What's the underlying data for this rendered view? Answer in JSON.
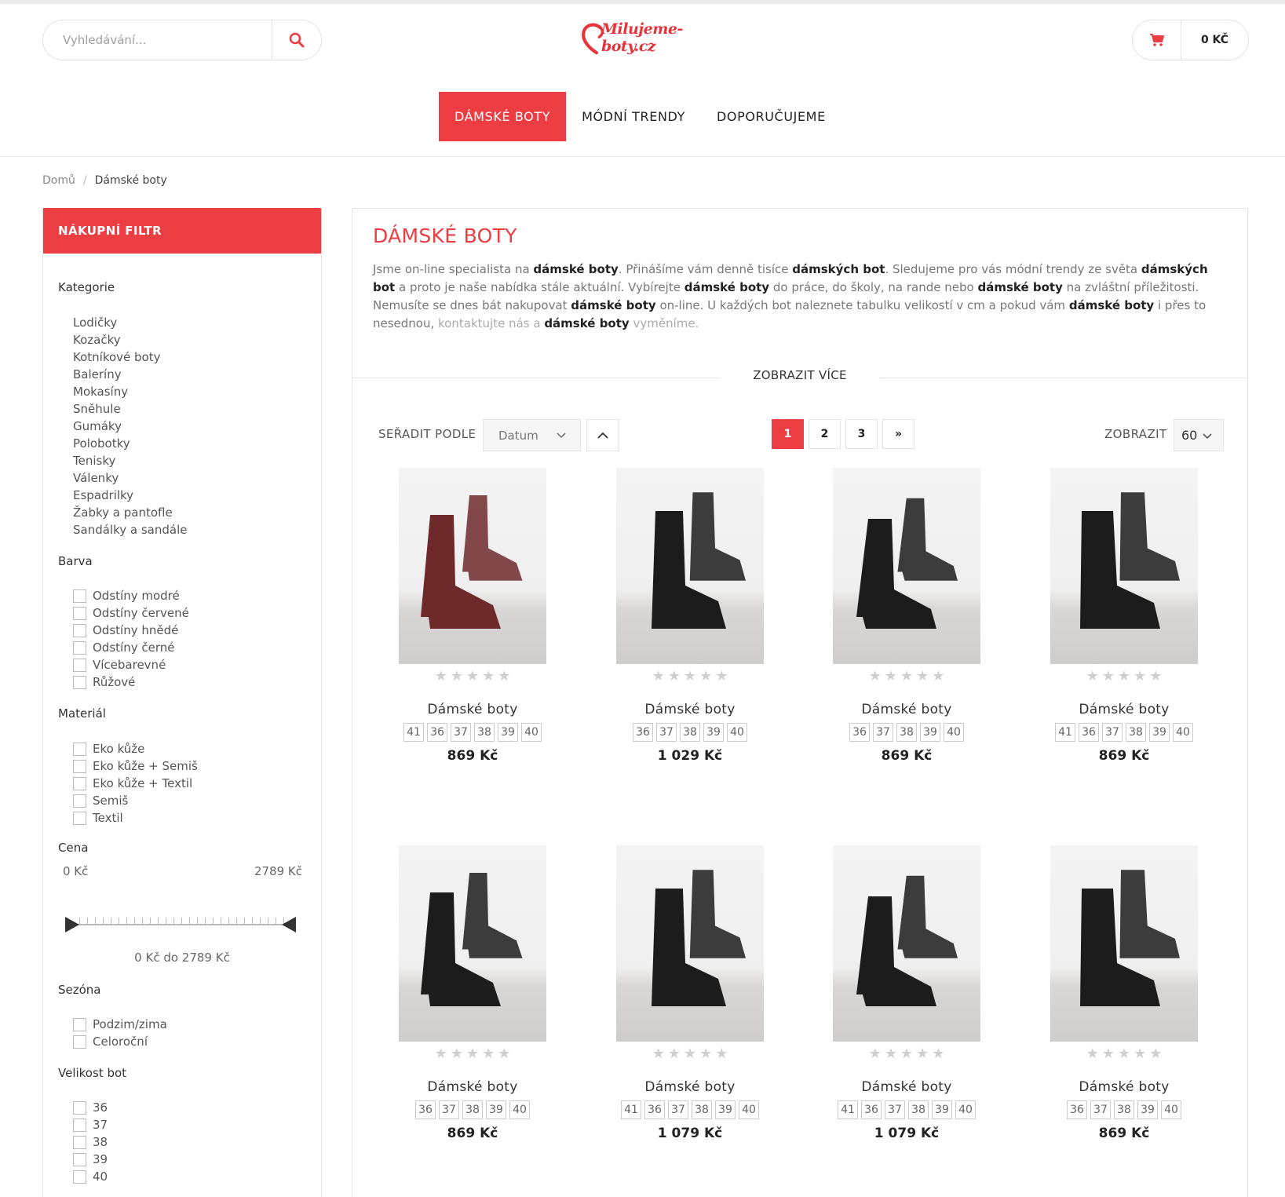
{
  "header": {
    "search_placeholder": "Vyhledávání...",
    "logo_text": "Milujeme-boty.cz",
    "cart_total": "0 KČ"
  },
  "nav": [
    {
      "label": "DÁMSKÉ BOTY",
      "active": true
    },
    {
      "label": "MÓDNÍ TRENDY",
      "active": false
    },
    {
      "label": "DOPORUČUJEME",
      "active": false
    }
  ],
  "breadcrumb": {
    "home": "Domů",
    "separator": "/",
    "current": "Dámské boty"
  },
  "filter": {
    "heading": "NÁKUPNÍ FILTR",
    "category_title": "Kategorie",
    "categories": [
      "Lodičky",
      "Kozačky",
      "Kotníkové boty",
      "Baleríny",
      "Mokasíny",
      "Sněhule",
      "Gumáky",
      "Polobotky",
      "Tenisky",
      "Válenky",
      "Espadrilky",
      "Žabky a pantofle",
      "Sandálky a sandále"
    ],
    "color_title": "Barva",
    "colors": [
      "Odstíny modré",
      "Odstíny červené",
      "Odstíny hnědé",
      "Odstíny černé",
      "Vícebarevné",
      "Růžové"
    ],
    "material_title": "Materiál",
    "materials": [
      "Eko kůže",
      "Eko kůže + Semiš",
      "Eko kůže + Textil",
      "Semiš",
      "Textil"
    ],
    "price_title": "Cena",
    "price_min": "0 Kč",
    "price_max": "2789 Kč",
    "price_range": "0 Kč do 2789 Kč",
    "season_title": "Sezóna",
    "seasons": [
      "Podzim/zima",
      "Celoroční"
    ],
    "size_title": "Velikost bot",
    "sizes": [
      "36",
      "37",
      "38",
      "39",
      "40"
    ]
  },
  "main": {
    "title": "DÁMSKÉ BOTY",
    "show_more": "ZOBRAZIT VÍCE",
    "sort_label": "SEŘADIT PODLE",
    "sort_value": "Datum",
    "pages": [
      "1",
      "2",
      "3",
      "»"
    ],
    "show_label": "ZOBRAZIT",
    "show_value": "60"
  },
  "products": [
    {
      "name": "Dámské boty",
      "sizes": [
        "41",
        "36",
        "37",
        "38",
        "39",
        "40"
      ],
      "price": "869 Kč",
      "shoe_color": "#6e2a2b"
    },
    {
      "name": "Dámské boty",
      "sizes": [
        "36",
        "37",
        "38",
        "39",
        "40"
      ],
      "price": "1 029 Kč",
      "shoe_color": "#1c1c1c"
    },
    {
      "name": "Dámské boty",
      "sizes": [
        "36",
        "37",
        "38",
        "39",
        "40"
      ],
      "price": "869 Kč",
      "shoe_color": "#1c1c1c"
    },
    {
      "name": "Dámské boty",
      "sizes": [
        "41",
        "36",
        "37",
        "38",
        "39",
        "40"
      ],
      "price": "869 Kč",
      "shoe_color": "#1c1c1c"
    },
    {
      "name": "Dámské boty",
      "sizes": [
        "36",
        "37",
        "38",
        "39",
        "40"
      ],
      "price": "869 Kč",
      "shoe_color": "#1c1c1c"
    },
    {
      "name": "Dámské boty",
      "sizes": [
        "41",
        "36",
        "37",
        "38",
        "39",
        "40"
      ],
      "price": "1 079 Kč",
      "shoe_color": "#1c1c1c"
    },
    {
      "name": "Dámské boty",
      "sizes": [
        "41",
        "36",
        "37",
        "38",
        "39",
        "40"
      ],
      "price": "1 079 Kč",
      "shoe_color": "#1c1c1c"
    },
    {
      "name": "Dámské boty",
      "sizes": [
        "36",
        "37",
        "38",
        "39",
        "40"
      ],
      "price": "869 Kč",
      "shoe_color": "#1c1c1c"
    }
  ],
  "colors": {
    "accent": "#ec3d43"
  }
}
